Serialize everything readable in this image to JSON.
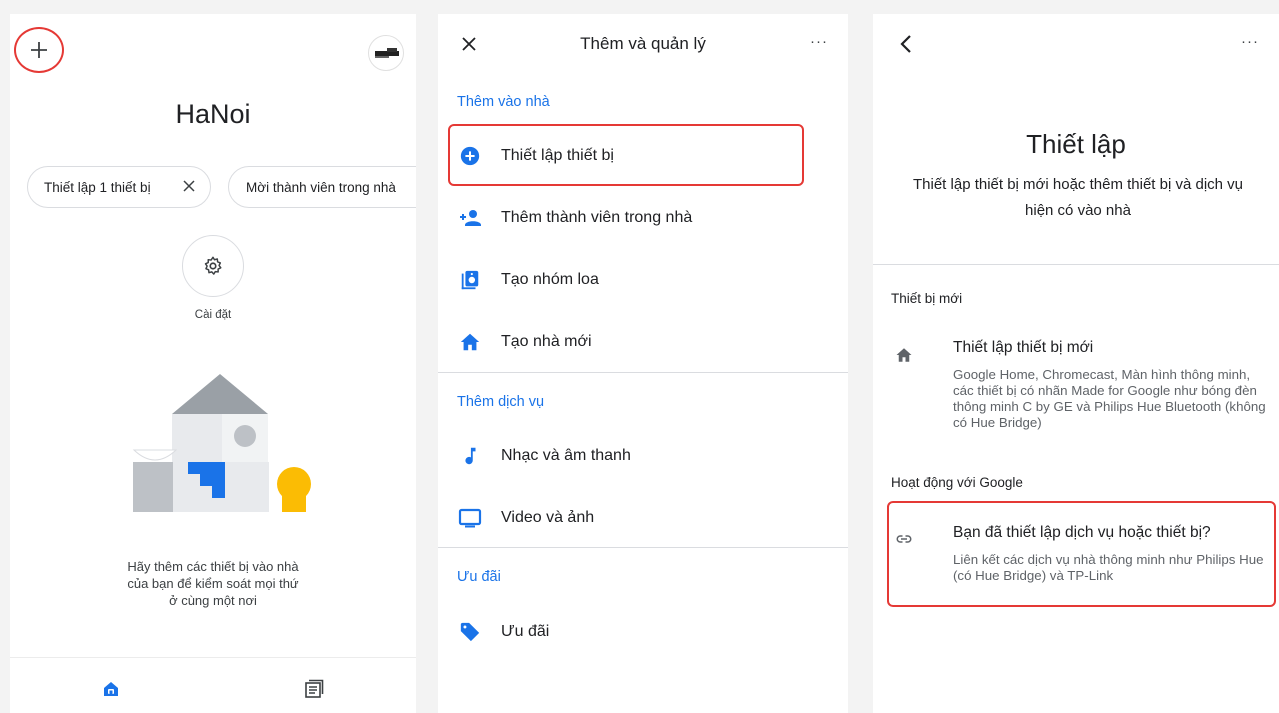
{
  "panel1": {
    "home_name": "HaNoi",
    "chips": [
      {
        "label": "Thiết lập 1 thiết bị"
      },
      {
        "label": "Mời thành viên trong nhà"
      }
    ],
    "settings_label": "Cài đặt",
    "empty_message": "Hãy thêm các thiết bị vào nhà của bạn để kiểm soát mọi thứ ở cùng một nơi",
    "icons": {
      "add": "plus-icon",
      "avatar": "avatar",
      "settings": "gear-icon",
      "nav_home": "home-icon",
      "nav_feed": "feed-icon"
    }
  },
  "panel2": {
    "title": "Thêm và quản lý",
    "more": "···",
    "sections": [
      {
        "header": "Thêm vào nhà",
        "items": [
          {
            "label": "Thiết lập thiết bị",
            "icon": "add-circle-icon"
          },
          {
            "label": "Thêm thành viên trong nhà",
            "icon": "person-add-icon"
          },
          {
            "label": "Tạo nhóm loa",
            "icon": "speaker-icon"
          },
          {
            "label": "Tạo nhà mới",
            "icon": "home-icon"
          }
        ]
      },
      {
        "header": "Thêm dịch vụ",
        "items": [
          {
            "label": "Nhạc và âm thanh",
            "icon": "music-note-icon"
          },
          {
            "label": "Video và ảnh",
            "icon": "tv-icon"
          }
        ]
      },
      {
        "header": "Ưu đãi",
        "items": [
          {
            "label": "Ưu đãi",
            "icon": "tag-icon"
          }
        ]
      }
    ]
  },
  "panel3": {
    "more": "···",
    "title": "Thiết lập",
    "subtitle": "Thiết lập thiết bị mới hoặc thêm thiết bị và dịch vụ hiện có vào nhà",
    "new_device_section": "Thiết bị mới",
    "new_device": {
      "title": "Thiết lập thiết bị mới",
      "description": "Google Home, Chromecast, Màn hình thông minh, các thiết bị có nhãn Made for Google như bóng đèn thông minh C by GE và Philips Hue Bluetooth (không có Hue Bridge)"
    },
    "works_with_section": "Hoạt động với Google",
    "existing": {
      "title": "Bạn đã thiết lập dịch vụ hoặc thiết bị?",
      "description": "Liên kết các dịch vụ nhà thông minh như Philips Hue (có Hue Bridge) và TP-Link"
    }
  },
  "colors": {
    "accent_blue": "#1a73e8",
    "highlight_red": "#e53935",
    "illustration_yellow": "#fbbc04"
  }
}
